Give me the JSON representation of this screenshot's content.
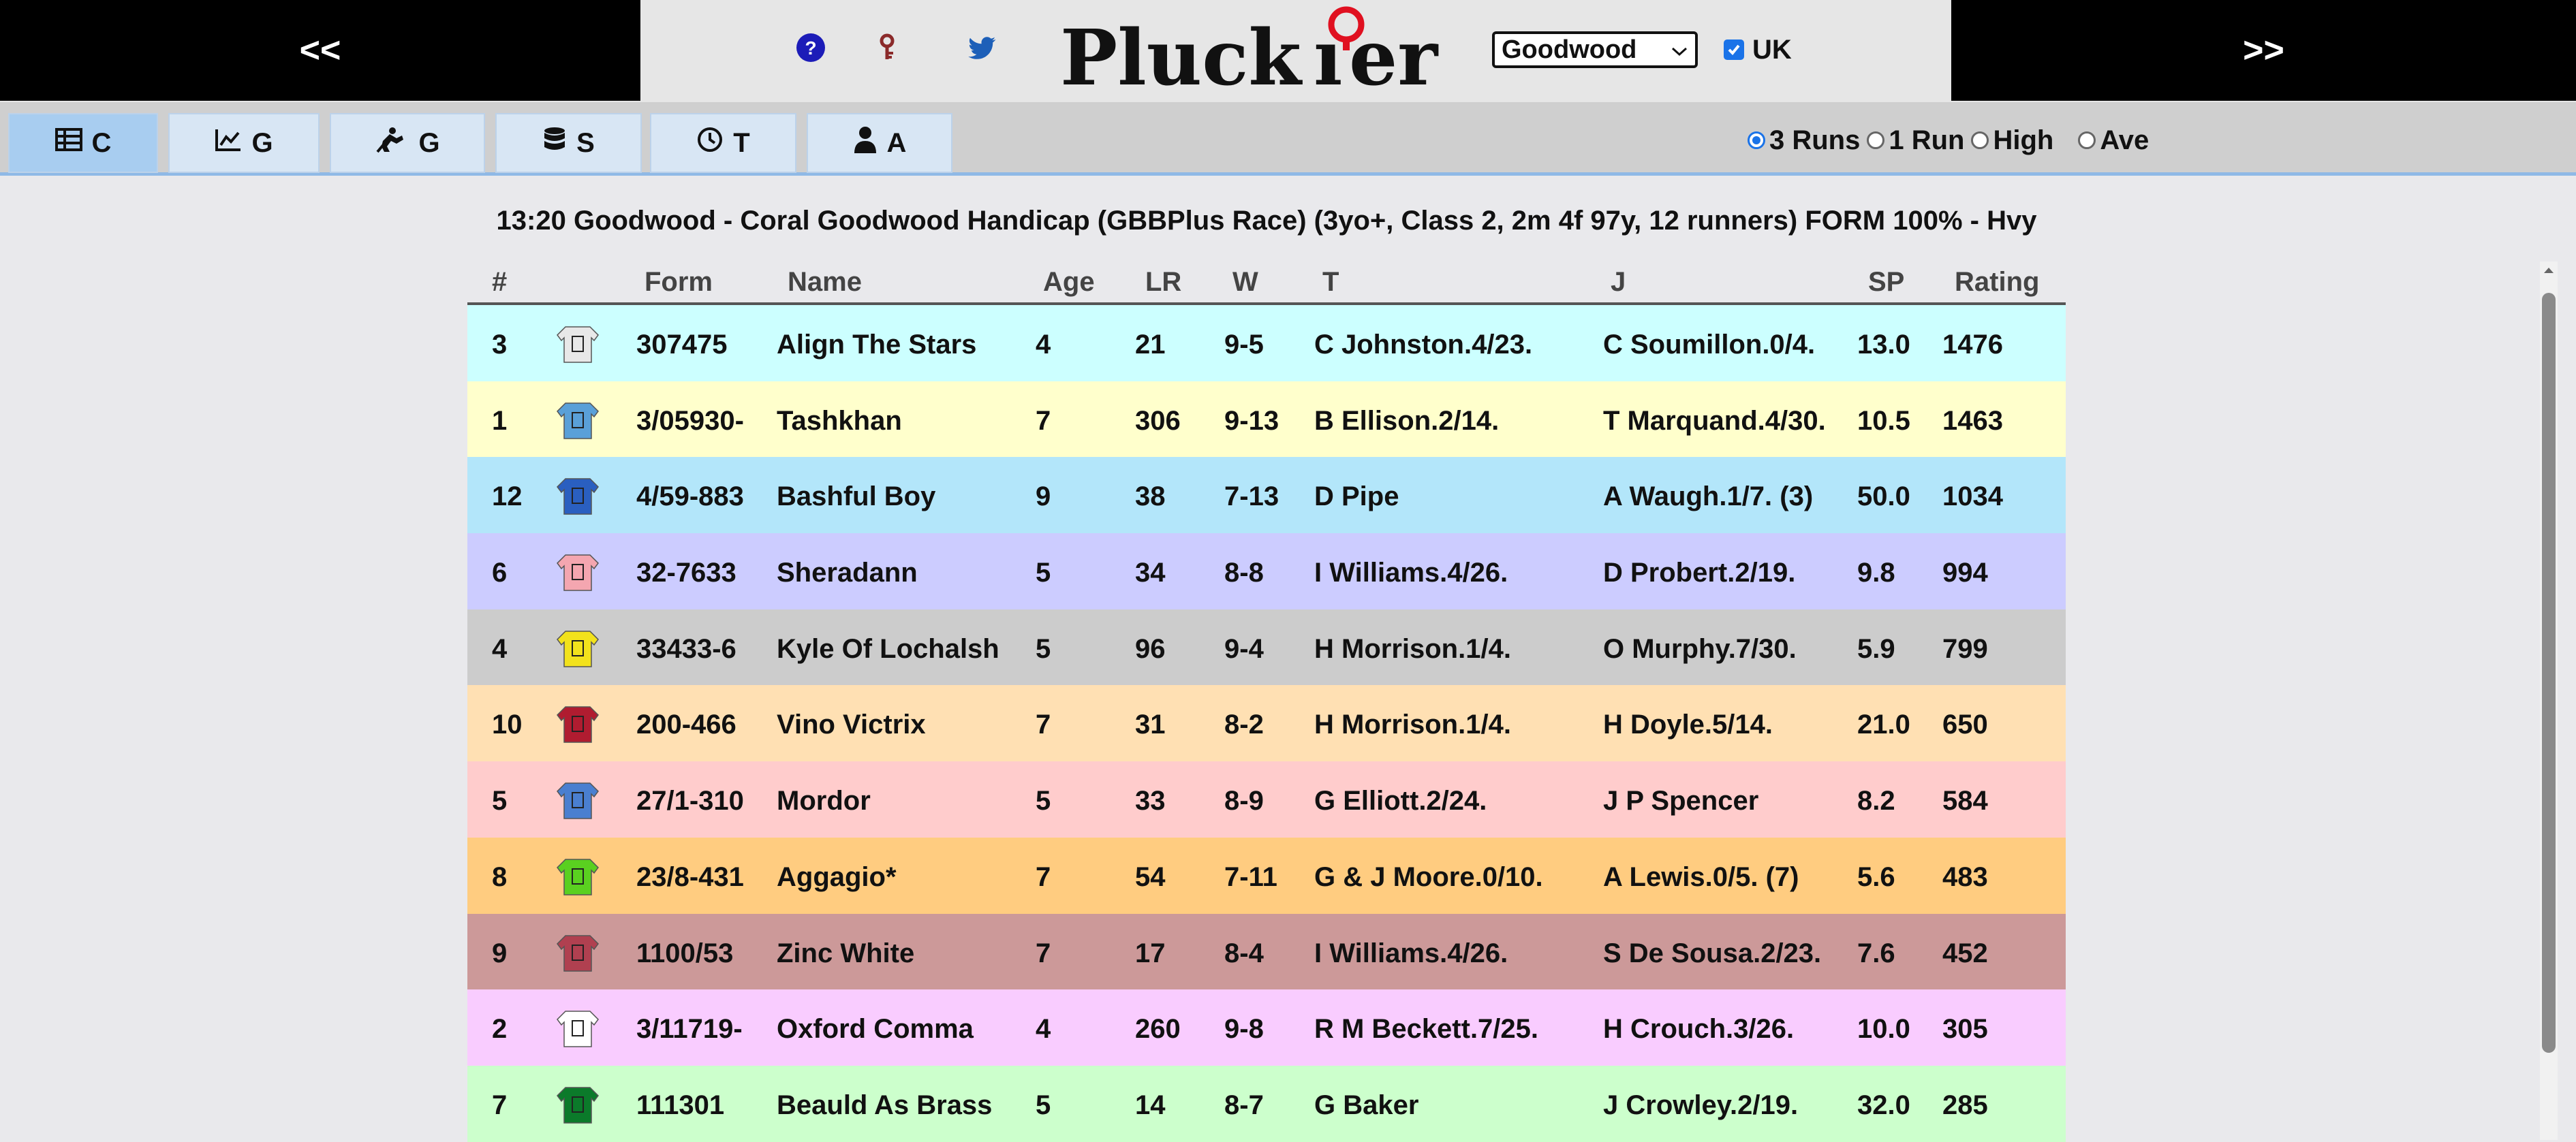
{
  "nav": {
    "prev_label": "<<",
    "next_label": ">>"
  },
  "header": {
    "logo_text": "Pluckier",
    "course_selected": "Goodwood",
    "uk_label": "UK",
    "uk_checked": true
  },
  "tabs": [
    {
      "label": "C",
      "icon": "table-icon",
      "active": true
    },
    {
      "label": "G",
      "icon": "line-chart-icon",
      "active": false
    },
    {
      "label": "G",
      "icon": "going-icon",
      "active": false
    },
    {
      "label": "S",
      "icon": "database-icon",
      "active": false
    },
    {
      "label": "T",
      "icon": "clock-icon",
      "active": false
    },
    {
      "label": "A",
      "icon": "person-icon",
      "active": false
    }
  ],
  "runs_options": [
    {
      "label": "3 Runs",
      "selected": true
    },
    {
      "label": "1 Run",
      "selected": false
    },
    {
      "label": "High",
      "selected": false
    },
    {
      "label": "Ave",
      "selected": false
    }
  ],
  "race": {
    "title": "13:20 Goodwood - Coral Goodwood Handicap (GBBPlus Race) (3yo+, Class 2, 2m 4f 97y, 12 runners) FORM 100% - Hvy"
  },
  "table": {
    "headers": {
      "num": "#",
      "form": "Form",
      "name": "Name",
      "age": "Age",
      "lr": "LR",
      "w": "W",
      "t": "T",
      "j": "J",
      "sp": "SP",
      "rating": "Rating"
    },
    "rows": [
      {
        "num": "3",
        "form": "307475",
        "name": "Align The Stars",
        "age": "4",
        "lr": "21",
        "w": "9-5",
        "t": "C Johnston.4/23.",
        "j": "C Soumillon.0/4.",
        "sp": "13.0",
        "rating": "1476",
        "bg": "#ccffff"
      },
      {
        "num": "1",
        "form": "3/05930-",
        "name": "Tashkhan",
        "age": "7",
        "lr": "306",
        "w": "9-13",
        "t": "B Ellison.2/14.",
        "j": "T Marquand.4/30.",
        "sp": "10.5",
        "rating": "1463",
        "bg": "#ffffcc"
      },
      {
        "num": "12",
        "form": "4/59-883",
        "name": "Bashful Boy",
        "age": "9",
        "lr": "38",
        "w": "7-13",
        "t": "D Pipe",
        "j": "A Waugh.1/7. (3)",
        "sp": "50.0",
        "rating": "1034",
        "bg": "#b3e6fa"
      },
      {
        "num": "6",
        "form": "32-7633",
        "name": "Sheradann",
        "age": "5",
        "lr": "34",
        "w": "8-8",
        "t": "I Williams.4/26.",
        "j": "D Probert.2/19.",
        "sp": "9.8",
        "rating": "994",
        "bg": "#ccccff"
      },
      {
        "num": "4",
        "form": "33433-6",
        "name": "Kyle Of Lochalsh",
        "age": "5",
        "lr": "96",
        "w": "9-4",
        "t": "H Morrison.1/4.",
        "j": "O Murphy.7/30.",
        "sp": "5.9",
        "rating": "799",
        "bg": "#cccccc"
      },
      {
        "num": "10",
        "form": "200-466",
        "name": "Vino Victrix",
        "age": "7",
        "lr": "31",
        "w": "8-2",
        "t": "H Morrison.1/4.",
        "j": "H Doyle.5/14.",
        "sp": "21.0",
        "rating": "650",
        "bg": "#ffe0b3"
      },
      {
        "num": "5",
        "form": "27/1-310",
        "name": "Mordor",
        "age": "5",
        "lr": "33",
        "w": "8-9",
        "t": "G Elliott.2/24.",
        "j": "J P Spencer",
        "sp": "8.2",
        "rating": "584",
        "bg": "#ffcccc"
      },
      {
        "num": "8",
        "form": "23/8-431",
        "name": "Aggagio*",
        "age": "7",
        "lr": "54",
        "w": "7-11",
        "t": "G & J Moore.0/10.",
        "j": "A Lewis.0/5. (7)",
        "sp": "5.6",
        "rating": "483",
        "bg": "#ffcc80"
      },
      {
        "num": "9",
        "form": "1100/53",
        "name": "Zinc White",
        "age": "7",
        "lr": "17",
        "w": "8-4",
        "t": "I Williams.4/26.",
        "j": "S De Sousa.2/23.",
        "sp": "7.6",
        "rating": "452",
        "bg": "#cc9999"
      },
      {
        "num": "2",
        "form": "3/11719-",
        "name": "Oxford Comma",
        "age": "4",
        "lr": "260",
        "w": "9-8",
        "t": "R M Beckett.7/25.",
        "j": "H Crouch.3/26.",
        "sp": "10.0",
        "rating": "305",
        "bg": "#f9ccff"
      },
      {
        "num": "7",
        "form": "111301",
        "name": "Beauld As Brass",
        "age": "5",
        "lr": "14",
        "w": "8-7",
        "t": "G Baker",
        "j": "J Crowley.2/19.",
        "sp": "32.0",
        "rating": "285",
        "bg": "#ccffcc"
      }
    ]
  }
}
